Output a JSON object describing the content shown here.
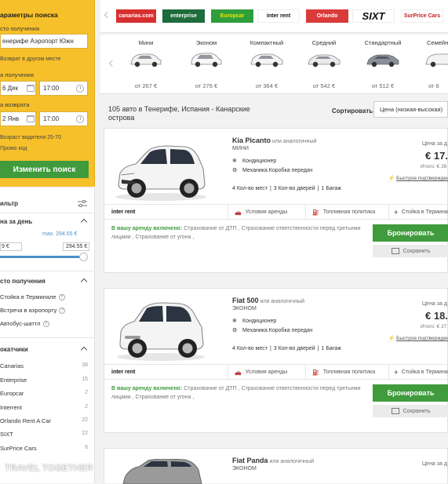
{
  "search": {
    "title": "араметры поиска",
    "pickup_label": "сто получения",
    "pickup_value": "енерифе Аэропорт Южн",
    "return_other": "Возврат в другом месте",
    "pickup_date_label": "а получения",
    "pickup_date": "6 Дек",
    "pickup_time": "17:00",
    "return_date_label": "а возврата",
    "return_date": "2 Янв",
    "return_time": "17:00",
    "driver_age": "Возраст водителя 25-70",
    "promo": "Промо код",
    "button": "Изменить поиск"
  },
  "filters": {
    "title": "ильтр",
    "price": {
      "title": "на за день",
      "max": "max. 294.55 €",
      "min_value": "9 €",
      "max_value": "294.55 €",
      "level": 1.0
    },
    "pickup_place": {
      "title": "сто получения",
      "items": [
        "Стойка в Терминале",
        "Встреча в аэропорту",
        "Автобус-шаттл"
      ]
    },
    "suppliers": {
      "title": "окатчики",
      "items": [
        {
          "name": "Canarias",
          "count": "38"
        },
        {
          "name": "Enterprise",
          "count": "15"
        },
        {
          "name": "Europcar",
          "count": "2"
        },
        {
          "name": "Interrent",
          "count": "2"
        },
        {
          "name": "Orlando Rent A Car",
          "count": "22"
        },
        {
          "name": "SIXT",
          "count": "22"
        },
        {
          "name": "SurPrice Cars",
          "count": "6"
        }
      ]
    }
  },
  "suppliers_strip": [
    {
      "name": "canarias.com",
      "bg": "#d62f2f",
      "fg": "#ffffff"
    },
    {
      "name": "enterprise",
      "bg": "#1e6b3c",
      "fg": "#ffffff"
    },
    {
      "name": "Europcar",
      "bg": "#2f9e3c",
      "fg": "#f2e600"
    },
    {
      "name": "inter rent",
      "bg": "#ffffff",
      "fg": "#111111"
    },
    {
      "name": "Orlando",
      "bg": "#d93a3a",
      "fg": "#ffffff"
    },
    {
      "name": "SIXT",
      "bg": "#ffffff",
      "fg": "#111111"
    },
    {
      "name": "SurPrice Cars",
      "bg": "#ffffff",
      "fg": "#c21d25"
    }
  ],
  "car_classes": [
    {
      "name": "Мини",
      "price": "от 267 €"
    },
    {
      "name": "Эконом",
      "price": "от 276 €"
    },
    {
      "name": "Компактный",
      "price": "от 364 €"
    },
    {
      "name": "Средний",
      "price": "от 542 €"
    },
    {
      "name": "Стандартный",
      "price": "от 512 €"
    },
    {
      "name": "Семейн",
      "price": "от 6"
    }
  ],
  "results": {
    "count_text": "105 авто в Тенерифе, Испания - Канарские острова",
    "sort_label": "Сортировать:",
    "sort_value": "Цена (низкая-высокая)"
  },
  "cars": [
    {
      "name": "Kia Picanto",
      "alt": "или аналогичный",
      "category": "МИНИ",
      "features": [
        "Кондиционер",
        "Механика Коробка передач"
      ],
      "specs": [
        "4 Кол-во мест",
        "3 Кол-во дверей",
        "1 Багаж"
      ],
      "price_label": "Цена за д",
      "price": "€ 17.",
      "total": "Итого: € 26",
      "fast_confirm": "Быстрое подтверждени",
      "supplier": "inter rent",
      "tabs": [
        "Условия аренды",
        "Топливная политика",
        "Стойка в Термина"
      ],
      "included_label": "В вашу аренду включено:",
      "included_text": "Страхование от ДТП , Страхование ответственности перед третьими лицами , Страхование от угона ,",
      "book": "Бронировать",
      "save": "Сохранить",
      "body_color": "#f4f4f4"
    },
    {
      "name": "Fiat 500",
      "alt": "или аналогичный",
      "category": "ЭКОНОМ",
      "features": [
        "Кондиционер",
        "Механика Коробка передач"
      ],
      "specs": [
        "4 Кол-во мест",
        "3 Кол-во дверей",
        "1 Багаж"
      ],
      "price_label": "Цена за д",
      "price": "€ 18.",
      "total": "Итого: € 27",
      "fast_confirm": "Быстрое подтверждени",
      "supplier": "inter rent",
      "tabs": [
        "Условия аренды",
        "Топливная политика",
        "Стойка в Термина"
      ],
      "included_label": "В вашу аренду включено:",
      "included_text": "Страхование от ДТП , Страхование ответственности перед третьими лицами , Страхование от угона ,",
      "book": "Бронировать",
      "save": "Сохранить",
      "body_color": "#f4f4f4"
    },
    {
      "name": "Fiat Panda",
      "alt": "или аналогичный",
      "category": "ЭКОНОМ",
      "price_label": "Цена за д",
      "body_color": "#9a9a9a"
    }
  ],
  "watermark": "TRAVEL TOGETHER",
  "colors": {
    "accent_yellow": "#f6c02a",
    "book_green": "#3f9b3c"
  }
}
